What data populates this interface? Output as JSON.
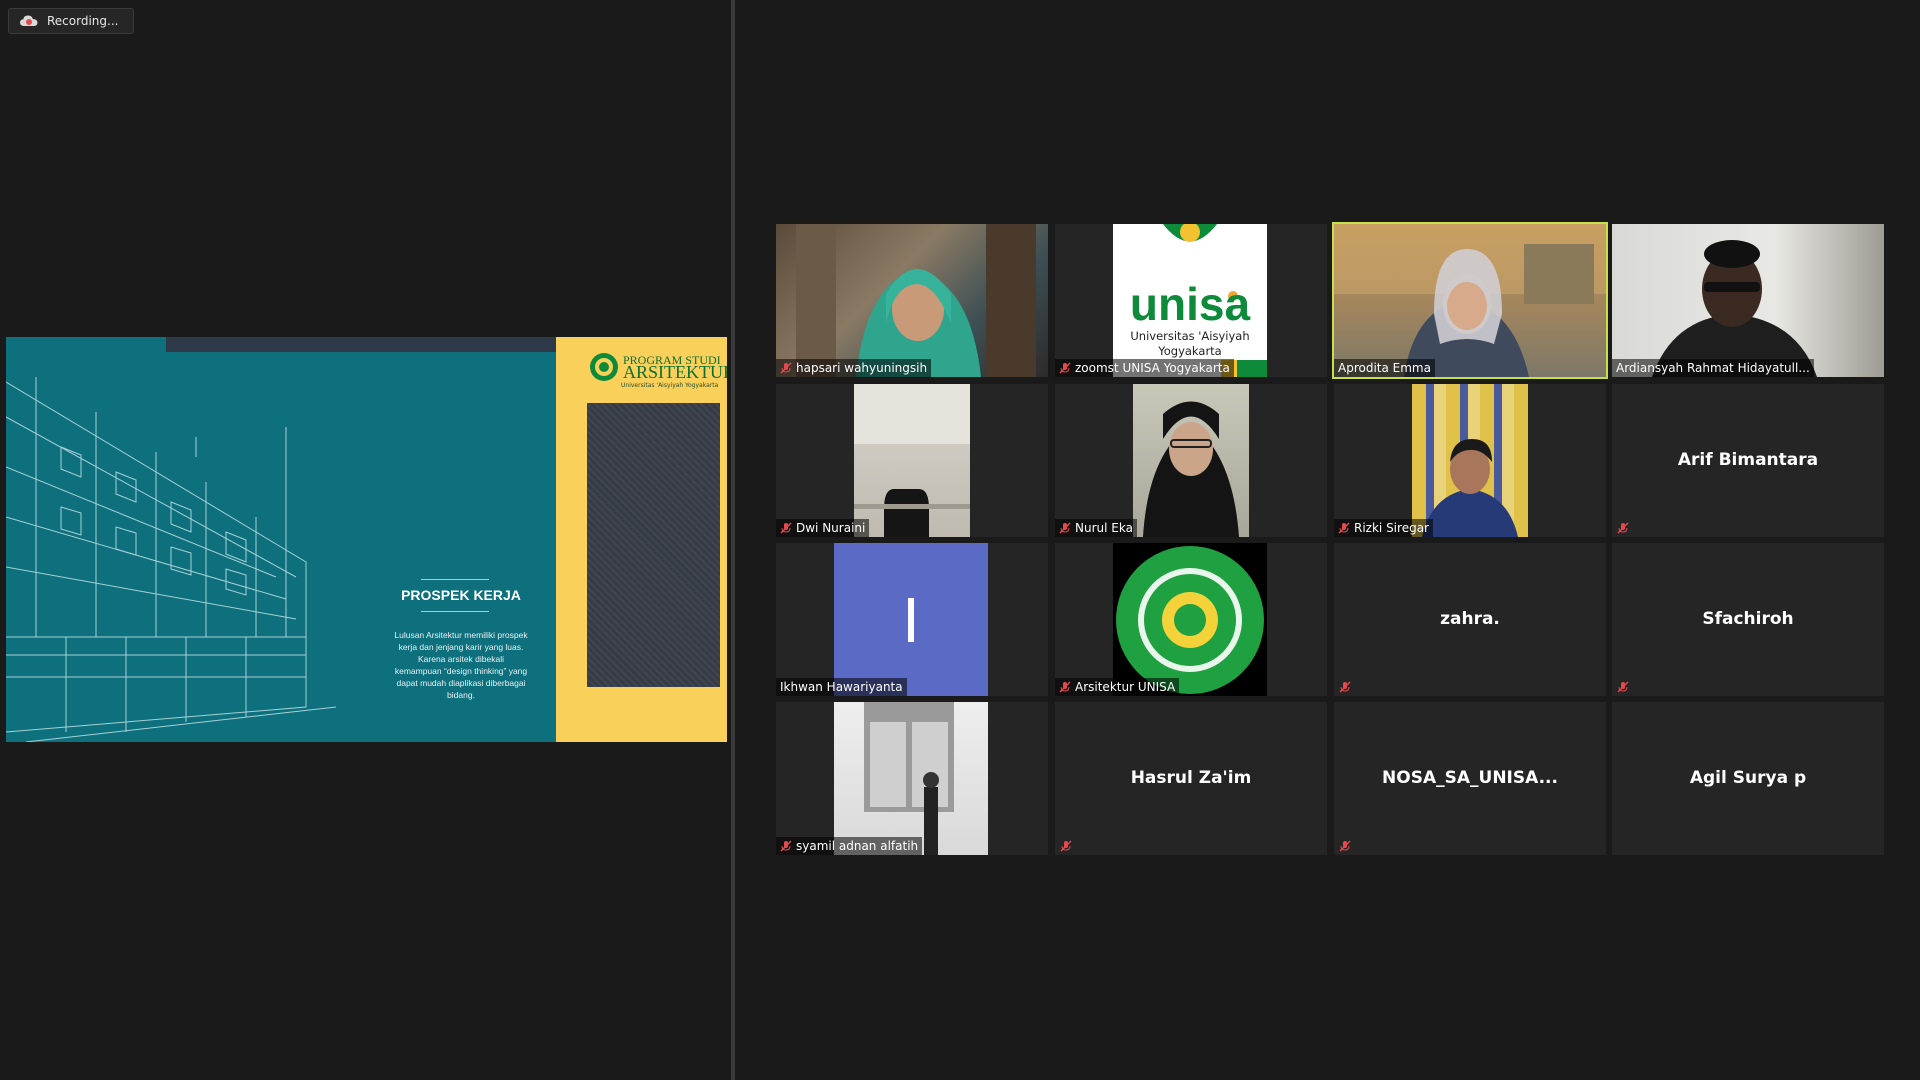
{
  "recording": {
    "label": "Recording..."
  },
  "slide": {
    "title": "PROSPEK KERJA",
    "body": "Lulusan Arsitektur memiliki prospek kerja dan jenjang karir yang luas. Karena arsitek dibekali kemampuan “design thinking” yang dapat mudah diaplikasi diberbagai bidang.",
    "logo_line1": "PROGRAM STUDI",
    "logo_line2": "ARSITEKTUR",
    "logo_line3": "Universitas 'Aisyiyah Yogyakarta"
  },
  "unisa_logo": {
    "wordmark": "unisa",
    "line1": "Universitas 'Aisyiyah",
    "line2": "Yogyakarta"
  },
  "participants": [
    {
      "name": "hapsari wahyuningsih"
    },
    {
      "name": "zoomst UNISA Yogyakarta"
    },
    {
      "name": "Aprodita Emma"
    },
    {
      "name": "Ardiansyah Rahmat Hidayatull..."
    },
    {
      "name": "Dwi Nuraini"
    },
    {
      "name": "Nurul Eka"
    },
    {
      "name": "Rizki Siregar"
    },
    {
      "name": "Arif Bimantara"
    },
    {
      "name": "Ikhwan Hawariyanta",
      "initial": "I"
    },
    {
      "name": "Arsitektur UNISA"
    },
    {
      "name": "zahra."
    },
    {
      "name": "Sfachiroh"
    },
    {
      "name": "syamil adnan alfatih"
    },
    {
      "name": "Hasrul Za'im"
    },
    {
      "name": "NOSA_SA_UNISA..."
    },
    {
      "name": "Agil Surya p"
    }
  ],
  "colors": {
    "active_speaker": "#c7e04a",
    "muted_icon": "#e5484d",
    "avatar_blue": "#5b6bc5"
  }
}
